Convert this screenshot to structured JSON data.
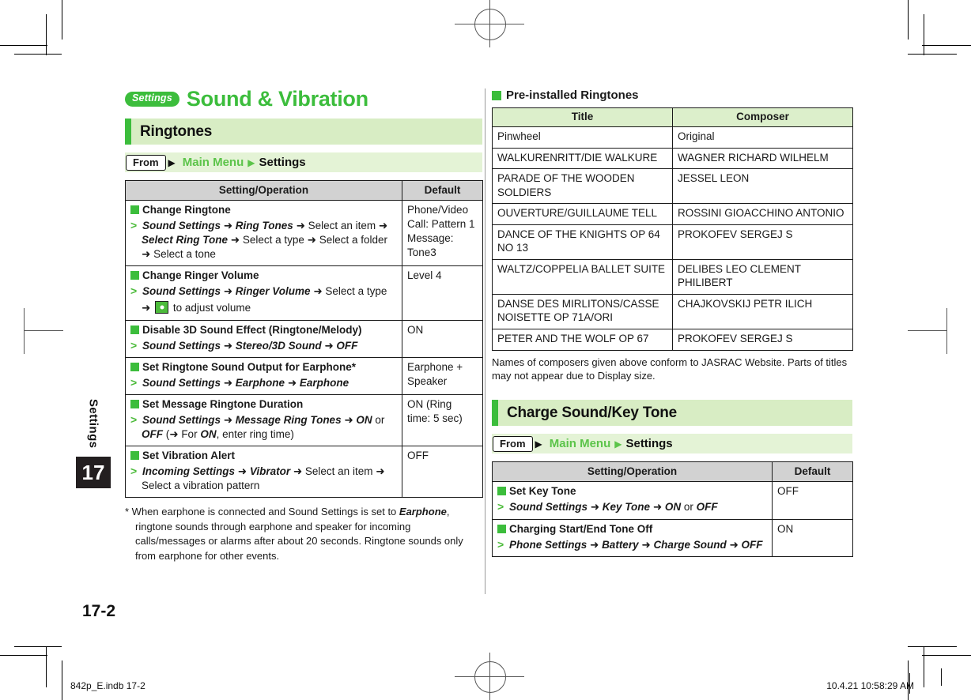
{
  "document": {
    "chapter_badge": "Settings",
    "chapter_title": "Sound & Vibration",
    "side_tab_label": "Settings",
    "side_tab_number": "17",
    "folio": "17-2",
    "footer_left": "842p_E.indb   17-2",
    "footer_right": "10.4.21   10:58:29 AM"
  },
  "colors": {
    "accent_green": "#3cbd3c",
    "section_bg": "#d8edc4",
    "from_bg": "#e4f3d6",
    "table_header_gray": "#d2d2d2",
    "table_header_green": "#dcefcb"
  },
  "left_column": {
    "section": {
      "title": "Ringtones"
    },
    "from": {
      "chip": "From",
      "path_start": "Main Menu",
      "path_end": "Settings"
    },
    "table": {
      "headers": [
        "Setting/Operation",
        "Default"
      ],
      "rows": [
        {
          "title": "Change Ringtone",
          "steps_html": "<span class=\"gt\">&gt;</span> <span class=\"bi\">Sound Settings</span> <span class=\"ar\">&#10140;</span> <span class=\"bi\">Ring Tones</span> <span class=\"ar\">&#10140;</span> Select an item <span class=\"ar\">&#10140;</span> <span class=\"bi\">Select Ring Tone</span> <span class=\"ar\">&#10140;</span> Select a type <span class=\"ar\">&#10140;</span> Select a folder <span class=\"ar\">&#10140;</span> Select a tone",
          "default": "Phone/Video Call: Pattern 1 Message: Tone3"
        },
        {
          "title": "Change Ringer Volume",
          "steps_html": "<span class=\"gt\">&gt;</span> <span class=\"bi\">Sound Settings</span> <span class=\"ar\">&#10140;</span> <span class=\"bi\">Ringer Volume</span> <span class=\"ar\">&#10140;</span> Select a type <span class=\"ar\">&#10140;</span> <span class=\"navkey\"></span> to adjust volume",
          "default": "Level 4"
        },
        {
          "title": "Disable 3D Sound Effect (Ringtone/Melody)",
          "steps_html": "<span class=\"gt\">&gt;</span> <span class=\"bi\">Sound Settings</span> <span class=\"ar\">&#10140;</span> <span class=\"bi\">Stereo/3D Sound</span> <span class=\"ar\">&#10140;</span> <span class=\"bi\">OFF</span>",
          "default": "ON"
        },
        {
          "title": "Set Ringtone Sound Output for Earphone*",
          "steps_html": "<span class=\"gt\">&gt;</span> <span class=\"bi\">Sound Settings</span> <span class=\"ar\">&#10140;</span> <span class=\"bi\">Earphone</span> <span class=\"ar\">&#10140;</span> <span class=\"bi\">Earphone</span>",
          "default": "Earphone + Speaker"
        },
        {
          "title": "Set Message Ringtone Duration",
          "steps_html": "<span class=\"gt\">&gt;</span> <span class=\"bi\">Sound Settings</span> <span class=\"ar\">&#10140;</span> <span class=\"bi\">Message Ring Tones</span> <span class=\"ar\">&#10140;</span> <span class=\"bi\">ON</span> or <span class=\"bi\">OFF</span> (<span class=\"ar\">&#10140;</span> For <span class=\"bi\">ON</span>, enter ring time)",
          "default": "ON (Ring time: 5 sec)"
        },
        {
          "title": "Set Vibration Alert",
          "steps_html": "<span class=\"gt\">&gt;</span> <span class=\"bi\">Incoming Settings</span> <span class=\"ar\">&#10140;</span> <span class=\"bi\">Vibrator</span> <span class=\"ar\">&#10140;</span> Select an item <span class=\"ar\">&#10140;</span> Select a vibration pattern",
          "default": "OFF"
        }
      ]
    },
    "footnote_html": "* When earphone is connected and Sound Settings is set to <span class=\"bi\">Earphone</span>, ringtone sounds through earphone and speaker for incoming calls/messages or alarms after about 20 seconds. Ringtone sounds only from earphone for other events."
  },
  "right_column": {
    "preinstalled": {
      "heading": "Pre-installed Ringtones",
      "headers": [
        "Title",
        "Composer"
      ],
      "rows": [
        [
          "Pinwheel",
          "Original"
        ],
        [
          "WALKURENRITT/DIE WALKURE",
          "WAGNER RICHARD WILHELM"
        ],
        [
          "PARADE OF THE WOODEN SOLDIERS",
          "JESSEL LEON"
        ],
        [
          "OUVERTURE/GUILLAUME TELL",
          "ROSSINI GIOACCHINO ANTONIO"
        ],
        [
          "DANCE OF THE KNIGHTS OP 64 NO 13",
          "PROKOFEV SERGEJ S"
        ],
        [
          "WALTZ/COPPELIA BALLET SUITE",
          "DELIBES LEO CLEMENT PHILIBERT"
        ],
        [
          "DANSE DES MIRLITONS/CASSE NOISETTE OP 71A/ORI",
          "CHAJKOVSKIJ PETR ILICH"
        ],
        [
          "PETER AND THE WOLF OP 67",
          "PROKOFEV SERGEJ S"
        ]
      ],
      "note": "Names of composers given above conform to JASRAC Website. Parts of titles may not appear due to Display size."
    },
    "section": {
      "title": "Charge Sound/Key Tone"
    },
    "from": {
      "chip": "From",
      "path_start": "Main Menu",
      "path_end": "Settings"
    },
    "table": {
      "headers": [
        "Setting/Operation",
        "Default"
      ],
      "rows": [
        {
          "title": "Set Key Tone",
          "steps_html": "<span class=\"gt\">&gt;</span> <span class=\"bi\">Sound Settings</span> <span class=\"ar\">&#10140;</span> <span class=\"bi\">Key Tone</span> <span class=\"ar\">&#10140;</span> <span class=\"bi\">ON</span> or <span class=\"bi\">OFF</span>",
          "default": "OFF"
        },
        {
          "title": "Charging Start/End Tone Off",
          "steps_html": "<span class=\"gt\">&gt;</span> <span class=\"bi\">Phone Settings</span> <span class=\"ar\">&#10140;</span> <span class=\"bi\">Battery</span> <span class=\"ar\">&#10140;</span> <span class=\"bi\">Charge Sound</span> <span class=\"ar\">&#10140;</span> <span class=\"bi\">OFF</span>",
          "default": "ON"
        }
      ]
    }
  }
}
